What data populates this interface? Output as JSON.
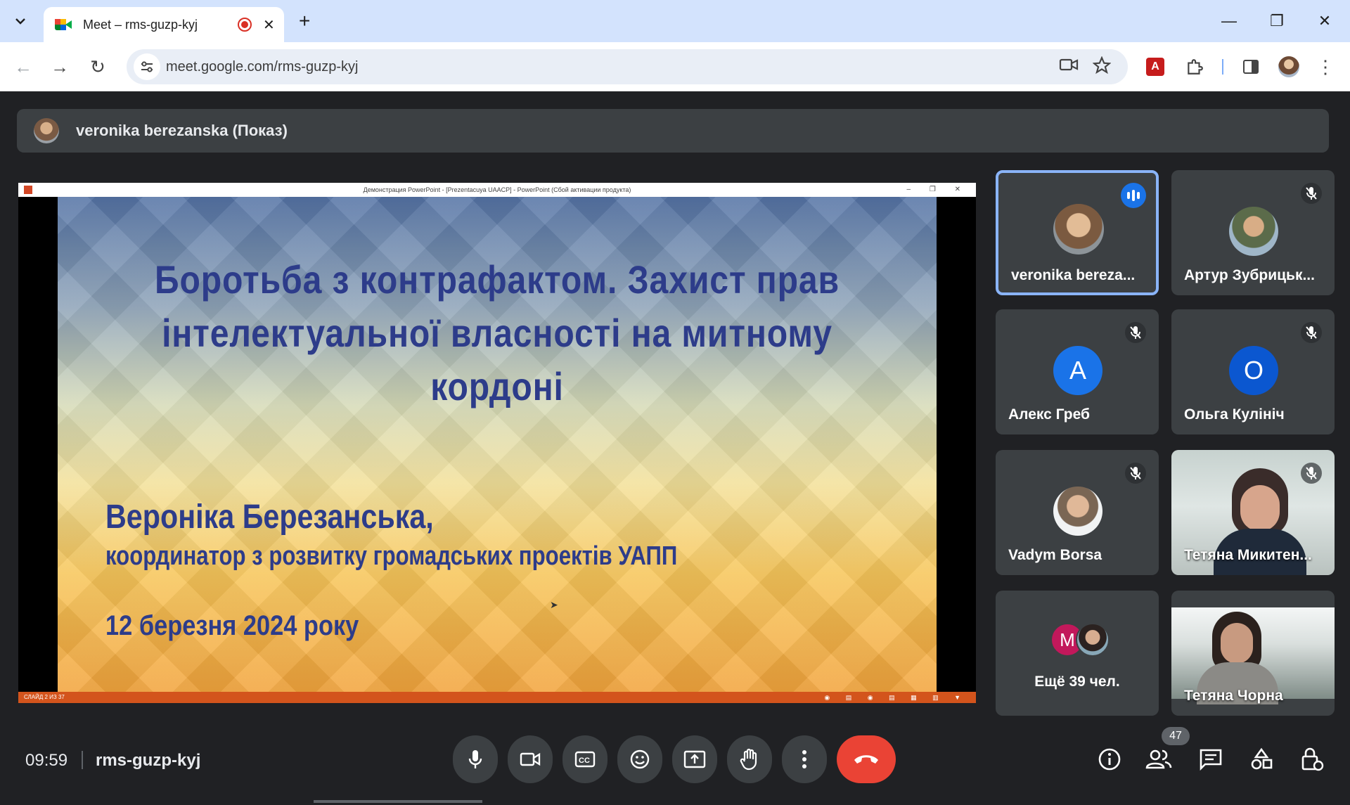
{
  "browser": {
    "tab_title": "Meet – rms-guzp-kyj",
    "tab_close": "✕",
    "new_tab": "+",
    "minimize": "—",
    "restore": "❐",
    "close": "✕",
    "back": "←",
    "forward": "→",
    "reload": "↻",
    "url": "meet.google.com/rms-guzp-kyj",
    "menu": "⋮"
  },
  "meet": {
    "presenter_label": "veronika berezanska (Показ)",
    "ppt_window_title": "Демонстрация PowerPoint - [Prezentacuya UAACP] - PowerPoint (Сбой активации продукта)",
    "slide": {
      "title": "Боротьба з контрафактом. Захист прав інтелектуальної власності на митному кордоні",
      "author": "Вероніка Березанська,",
      "role": "координатор з розвитку громадських проектів УАПП",
      "date": "12 березня 2024 року"
    },
    "ppt_status": "СЛАЙД 2 ИЗ 37",
    "participants": [
      {
        "name": "veronika bereza...",
        "state": "speaking"
      },
      {
        "name": "Артур Зубрицьк...",
        "state": "muted"
      },
      {
        "name": "Алекс Греб",
        "initial": "А",
        "color": "#1a73e8",
        "state": "muted"
      },
      {
        "name": "Ольга Кулініч",
        "initial": "О",
        "color": "#0b57d0",
        "state": "muted"
      },
      {
        "name": "Vadym Borsa",
        "state": "muted"
      },
      {
        "name": "Тетяна Микитен...",
        "state": "muted"
      },
      {
        "name": "Тетяна Чорна",
        "state": "video"
      }
    ],
    "more": {
      "label": "Ещё 39 чел.",
      "initial": "M"
    },
    "time": "09:59",
    "meeting_code": "rms-guzp-kyj",
    "people_count": "47"
  }
}
